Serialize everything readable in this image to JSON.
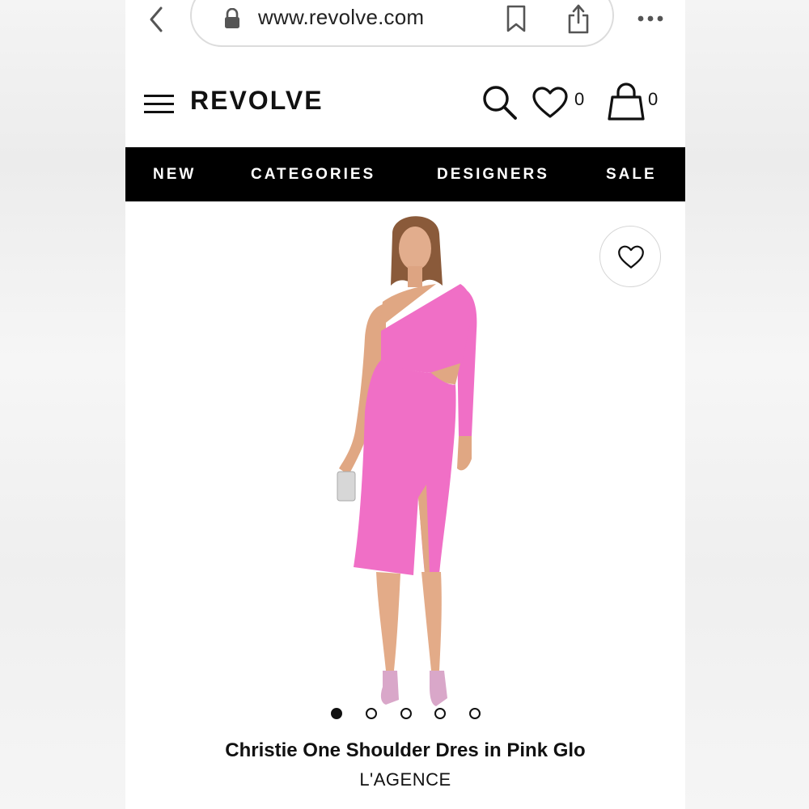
{
  "browser": {
    "url": "www.revolve.com",
    "icons": [
      "back-icon",
      "lock-icon",
      "bookmark-icon",
      "share-icon",
      "more-icon"
    ]
  },
  "header": {
    "logo": "REVOLVE",
    "wishlist_count": "0",
    "bag_count": "0",
    "icons": [
      "menu-icon",
      "search-icon",
      "heart-icon",
      "bag-icon"
    ]
  },
  "nav": {
    "items": [
      {
        "label": "NEW"
      },
      {
        "label": "CATEGORIES"
      },
      {
        "label": "DESIGNERS"
      },
      {
        "label": "SALE"
      }
    ]
  },
  "product": {
    "title": "Christie One Shoulder Dres in Pink Glo",
    "brand": "L'AGENCE",
    "image_count": 5,
    "active_image": 1,
    "dress_color": "#f06fc6"
  },
  "colors": {
    "nav_background": "#000000",
    "nav_text": "#ffffff"
  }
}
